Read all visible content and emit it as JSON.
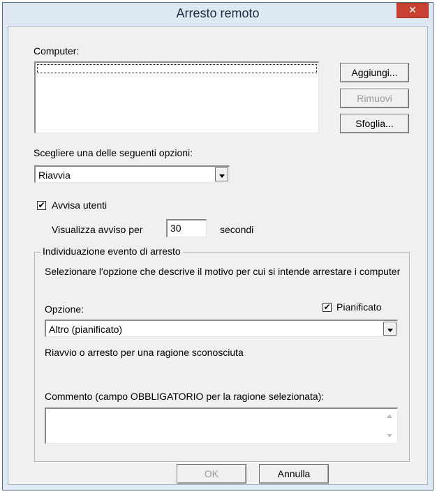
{
  "window": {
    "title": "Arresto remoto",
    "close_glyph": "✕"
  },
  "computer": {
    "label": "Computer:",
    "add_button": "Aggiungi...",
    "remove_button": "Rimuovi",
    "browse_button": "Sfoglia..."
  },
  "options": {
    "label": "Scegliere una delle seguenti opzioni:",
    "selected": "Riavvia"
  },
  "notify": {
    "checkbox_label": "Avvisa utenti",
    "checked": true,
    "display_label": "Visualizza avviso per",
    "seconds_value": "30",
    "seconds_unit": "secondi"
  },
  "shutdown_event": {
    "group_title": "Individuazione evento di arresto",
    "description": "Selezionare l'opzione che descrive il motivo per cui si intende arrestare i computer",
    "option_label": "Opzione:",
    "planned_label": "Pianificato",
    "planned_checked": true,
    "option_selected": "Altro (pianificato)",
    "reason_text": "Riavvio o arresto per una ragione sconosciuta",
    "comment_label": "Commento (campo OBBLIGATORIO per la ragione selezionata):",
    "comment_value": ""
  },
  "footer": {
    "ok_button": "OK",
    "cancel_button": "Annulla"
  },
  "icons": {
    "check_glyph": "✔"
  }
}
